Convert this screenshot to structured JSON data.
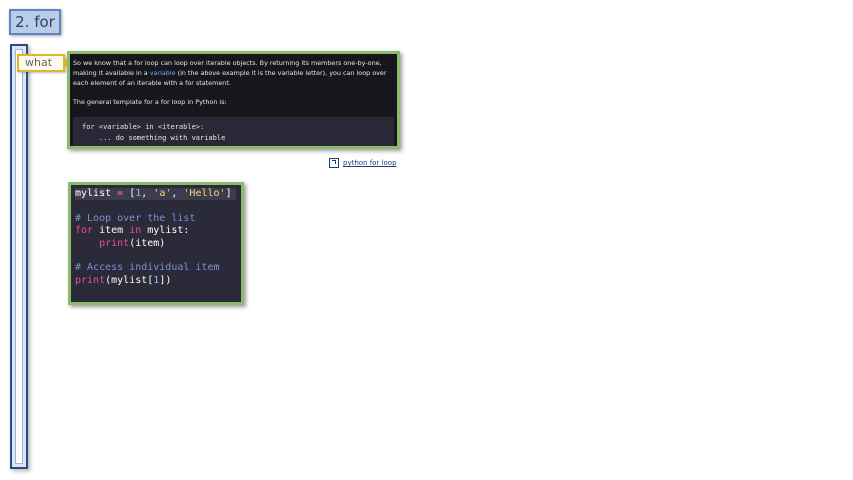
{
  "slide": {
    "title": "2. for"
  },
  "tag": {
    "label": "what"
  },
  "doc": {
    "para1_a": "So we know that a for loop can loop over iterable objects. By returning its members one-by-one, making it available in a ",
    "para1_kw": "variable",
    "para1_b": " (in the above example it is the variable letter), you can loop over each element of an iterable with a for statement.",
    "para2": "The general template for a for loop in Python is:",
    "code_line1": "for <variable> in <iterable>:",
    "code_line2": "    ... do something with variable"
  },
  "link": {
    "label": "python for loop",
    "icon": "external-link-icon"
  },
  "code": {
    "l1_a": "mylist",
    "l1_op": " = ",
    "l1_b": "[",
    "l1_n": "1",
    "l1_c": ", ",
    "l1_s1": "'a'",
    "l1_d": ", ",
    "l1_s2": "'Hello'",
    "l1_e": "]",
    "l3": "# Loop over the list",
    "l4_kw1": "for",
    "l4_a": " item ",
    "l4_kw2": "in",
    "l4_b": " mylist:",
    "l5_pad": "    ",
    "l5_fn": "print",
    "l5_b": "(item)",
    "l7": "# Access individual item",
    "l8_fn": "print",
    "l8_a": "(mylist[",
    "l8_n": "1",
    "l8_b": "])"
  },
  "colors": {
    "accent": "#5d84c3",
    "panel_border": "#8dbb6e",
    "keyword": "#e54ea0",
    "comment": "#7a93d4",
    "string": "#ffd77a"
  }
}
